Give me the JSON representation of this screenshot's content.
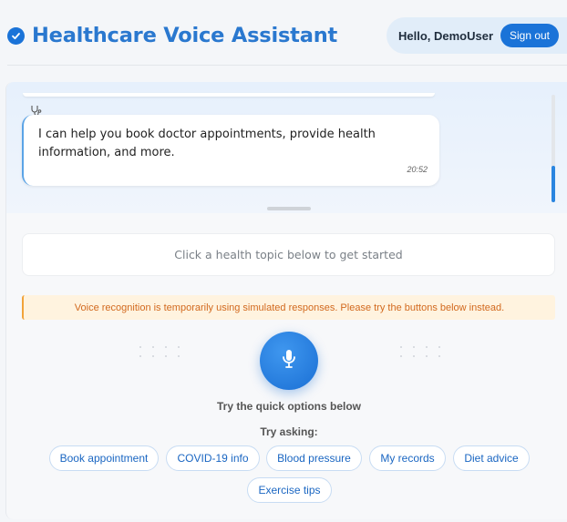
{
  "header": {
    "title": "Healthcare Voice Assistant",
    "greeting": "Hello, DemoUser",
    "signout_label": "Sign out",
    "brand_icon": "check-circle-icon"
  },
  "chat": {
    "messages": [
      {
        "sender_icon": "stethoscope-icon",
        "text": "I can help you book doctor appointments, provide health information, and more.",
        "time": "20:52"
      }
    ]
  },
  "prompt": {
    "text": "Click a health topic below to get started"
  },
  "warning": {
    "text": "Voice recognition is temporarily using simulated responses. Please try the buttons below instead."
  },
  "mic": {
    "icon": "microphone-icon",
    "hint": "Try the quick options below"
  },
  "suggestions": {
    "heading": "Try asking:",
    "chips": [
      "Book appointment",
      "COVID-19 info",
      "Blood pressure",
      "My records",
      "Diet advice",
      "Exercise tips"
    ]
  },
  "colors": {
    "accent": "#1a73d8",
    "title": "#2a78cf",
    "warning_text": "#d2691e",
    "warning_bg": "#fff3df"
  }
}
